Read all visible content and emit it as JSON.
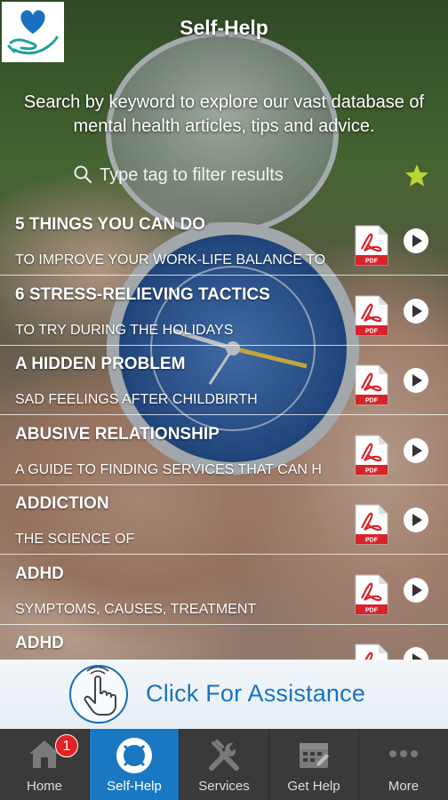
{
  "header": {
    "title": "Self-Help",
    "intro": "Search by keyword to explore our vast database of mental health articles, tips and advice."
  },
  "search": {
    "placeholder": "Type tag to filter results",
    "favorites_icon": "star-icon",
    "favorites_color": "#b7d633"
  },
  "articles": [
    {
      "title": "5 THINGS YOU CAN DO",
      "subtitle": "TO IMPROVE YOUR WORK-LIFE BALANCE TO"
    },
    {
      "title": "6 STRESS-RELIEVING TACTICS",
      "subtitle": "TO TRY DURING THE HOLIDAYS"
    },
    {
      "title": "A HIDDEN PROBLEM",
      "subtitle": "SAD FEELINGS AFTER CHILDBIRTH"
    },
    {
      "title": "ABUSIVE RELATIONSHIP",
      "subtitle": "A GUIDE TO FINDING SERVICES THAT CAN H"
    },
    {
      "title": "ADDICTION",
      "subtitle": "THE SCIENCE OF"
    },
    {
      "title": "ADHD",
      "subtitle": "SYMPTOMS, CAUSES, TREATMENT"
    },
    {
      "title": "ADHD",
      "subtitle": ""
    }
  ],
  "assist": {
    "label": "Click For Assistance",
    "color": "#1a73bf"
  },
  "tabs": [
    {
      "label": "Home",
      "icon": "home-icon",
      "badge": "1"
    },
    {
      "label": "Self-Help",
      "icon": "lifebuoy-icon",
      "active": true
    },
    {
      "label": "Services",
      "icon": "tools-icon"
    },
    {
      "label": "Get Help",
      "icon": "calendar-icon"
    },
    {
      "label": "More",
      "icon": "more-icon"
    }
  ],
  "colors": {
    "tab_active": "#1a78c2",
    "tab_bar": "#3a3a3a",
    "logo_heart": "#1a6fbf",
    "logo_hands": "#1fa39a"
  }
}
